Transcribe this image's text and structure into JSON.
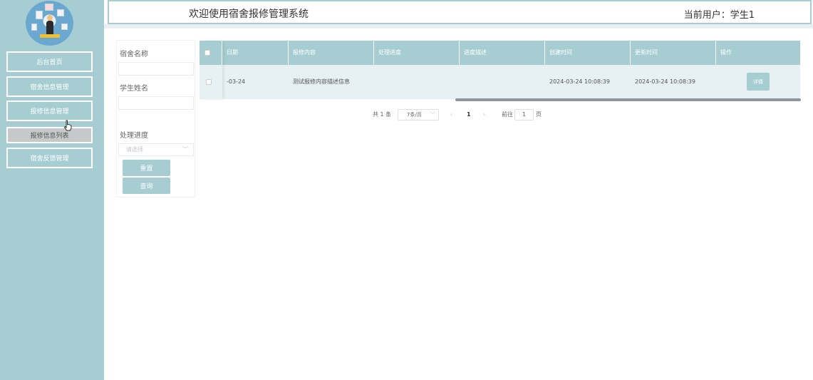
{
  "sidebar": {
    "items": [
      {
        "label": "后台首页"
      },
      {
        "label": "宿舍信息管理"
      },
      {
        "label": "报修信息管理"
      },
      {
        "label": "报修信息列表"
      },
      {
        "label": "宿舍反馈管理"
      }
    ]
  },
  "header": {
    "title": "欢迎使用宿舍报修管理系统",
    "user": "当前用户：学生1"
  },
  "search": {
    "dorm_label": "宿舍名称",
    "student_label": "学生姓名",
    "status_label": "处理进度",
    "status_placeholder": "请选择",
    "reset_label": "重置",
    "query_label": "查询"
  },
  "table": {
    "columns": [
      "日期",
      "报修内容",
      "处理进度",
      "进度描述",
      "创建时间",
      "更新时间",
      "操作"
    ],
    "rows": [
      {
        "date": "-03-24",
        "content": "测试报修内容描述信息",
        "status": "",
        "status_desc": "",
        "created": "2024-03-24 10:08:39",
        "updated": "2024-03-24 10:08:39",
        "action": "详情"
      }
    ]
  },
  "pager": {
    "total": "共 1 条",
    "page_size": "7条/页",
    "prev": "‹",
    "current": "1",
    "next": "›",
    "goto_prefix": "前往",
    "goto_value": "1",
    "goto_suffix": "页"
  },
  "colors": {
    "accent": "#a6ced2",
    "row_bg": "#e7f0f2",
    "sub_item_bg": "#c6c9c9"
  }
}
